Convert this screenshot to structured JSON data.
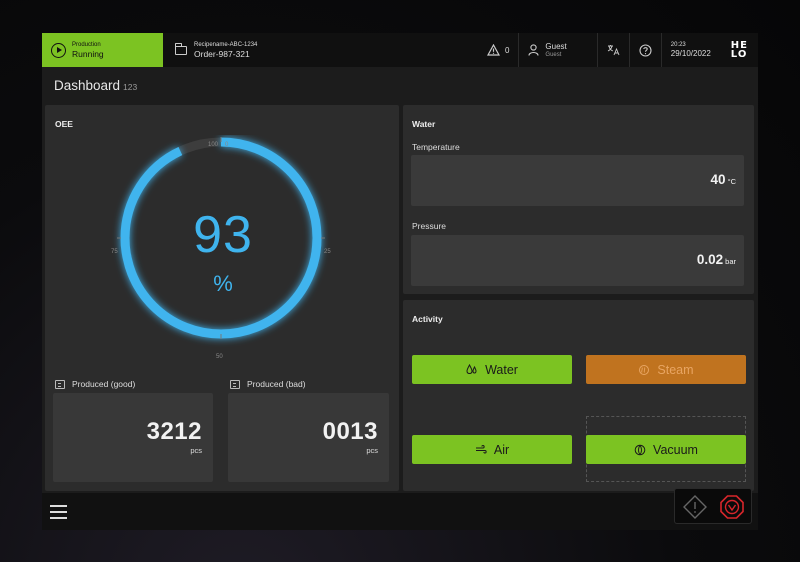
{
  "topbar": {
    "status_caption": "Production",
    "status_value": "Running",
    "recipe_name": "Recipename-ABC-1234",
    "order": "Order-987-321",
    "alert_count": "0",
    "user_name": "Guest",
    "user_role": "Guest",
    "time": "20:23",
    "date": "29/10/2022",
    "logo_line1": "HE",
    "logo_line2": "LO"
  },
  "dashboard": {
    "title": "Dashboard",
    "subtitle": "123"
  },
  "oee": {
    "title": "OEE",
    "value": "93",
    "unit": "%",
    "fraction": 0.93,
    "scale_labels": {
      "top_left": "100",
      "top_right": "0",
      "right": "25",
      "bottom": "50",
      "left": "75"
    }
  },
  "counters": [
    {
      "label": "Produced (good)",
      "value": "3212",
      "unit": "pcs"
    },
    {
      "label": "Produced (bad)",
      "value": "0013",
      "unit": "pcs"
    }
  ],
  "water": {
    "title": "Water",
    "temperature_label": "Temperature",
    "temperature_value": "40",
    "temperature_unit": "°C",
    "pressure_label": "Pressure",
    "pressure_value": "0.02",
    "pressure_unit": "bar"
  },
  "activity": {
    "title": "Activity",
    "buttons": [
      {
        "label": "Water",
        "icon": "water-drops-icon",
        "state": "active",
        "color": "#7cc322"
      },
      {
        "label": "Steam",
        "icon": "steam-icon",
        "state": "warning",
        "color": "#c0731f"
      },
      {
        "label": "Air",
        "icon": "air-icon",
        "state": "active",
        "color": "#7cc322"
      },
      {
        "label": "Vacuum",
        "icon": "vacuum-icon",
        "state": "active",
        "color": "#7cc322"
      }
    ]
  },
  "colors": {
    "accent_green": "#7cc322",
    "gauge_blue": "#3fb4ee",
    "warning_orange": "#c0731f",
    "stop_red": "#d8262b"
  }
}
